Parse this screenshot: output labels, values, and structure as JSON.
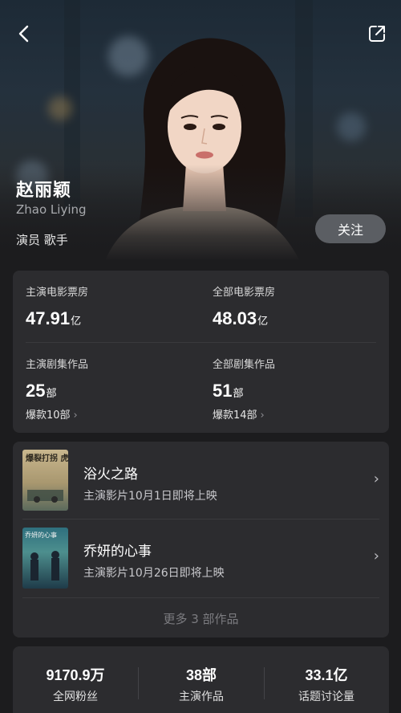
{
  "header": {
    "name": "赵丽颖",
    "name_en": "Zhao Liying",
    "roles": "演员 歌手",
    "follow_label": "关注",
    "back_icon": "chevron-left-icon",
    "share_icon": "share-icon"
  },
  "stats": [
    {
      "label": "主演电影票房",
      "value": "47.91",
      "unit": "亿",
      "sub": ""
    },
    {
      "label": "全部电影票房",
      "value": "48.03",
      "unit": "亿",
      "sub": ""
    },
    {
      "label": "主演剧集作品",
      "value": "25",
      "unit": "部",
      "sub": "爆款10部"
    },
    {
      "label": "全部剧集作品",
      "value": "51",
      "unit": "部",
      "sub": "爆款14部"
    }
  ],
  "works": {
    "items": [
      {
        "title": "浴火之路",
        "subtitle": "主演影片10月1日即将上映",
        "poster_text": "爆裂打拐 虎狼营救"
      },
      {
        "title": "乔妍的心事",
        "subtitle": "主演影片10月26日即将上映",
        "poster_text": "乔妍的心事"
      }
    ],
    "more_label": "更多 3 部作品"
  },
  "summary": [
    {
      "value": "9170.9万",
      "label": "全网粉丝"
    },
    {
      "value": "38部",
      "label": "主演作品"
    },
    {
      "value": "33.1亿",
      "label": "话题讨论量"
    }
  ],
  "colors": {
    "background": "#1c1c1e",
    "card": "#2c2c2f",
    "follow_button": "#5b5e63"
  }
}
